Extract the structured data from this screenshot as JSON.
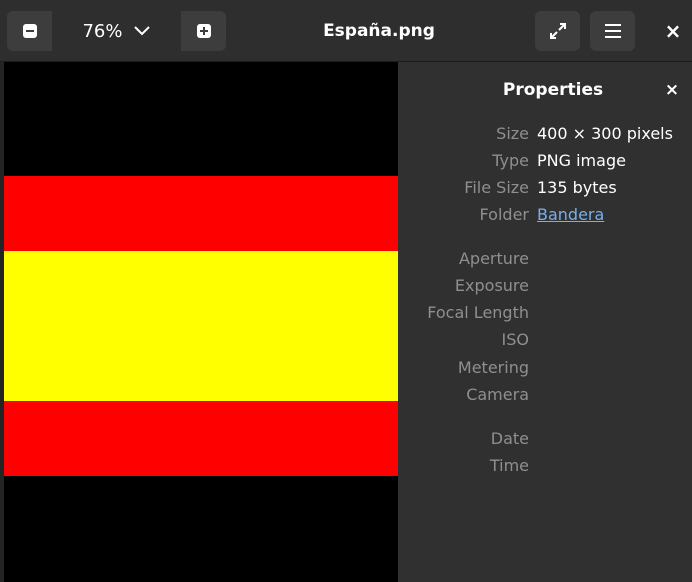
{
  "header": {
    "zoom_level": "76%",
    "title": "España.png",
    "icons": {
      "zoom_out": "minus-icon",
      "zoom_dropdown": "chevron-down-icon",
      "zoom_in": "plus-icon",
      "fullscreen": "expand-icon",
      "menu": "hamburger-menu-icon",
      "close": "close-icon"
    },
    "close_glyph": "×"
  },
  "image": {
    "colors": {
      "background": "#000000",
      "red": "#ff0000",
      "yellow": "#ffff00"
    }
  },
  "properties": {
    "title": "Properties",
    "close_glyph": "×",
    "size_label": "Size",
    "size_value": "400 × 300 pixels",
    "type_label": "Type",
    "type_value": "PNG image",
    "filesize_label": "File Size",
    "filesize_value": "135 bytes",
    "folder_label": "Folder",
    "folder_value": "Bandera",
    "aperture_label": "Aperture",
    "exposure_label": "Exposure",
    "focal_label": "Focal Length",
    "iso_label": "ISO",
    "metering_label": "Metering",
    "camera_label": "Camera",
    "date_label": "Date",
    "time_label": "Time"
  },
  "colors": {
    "accent_link": "#78aeed",
    "panel_bg": "#303030",
    "header_bg": "#2e2e2e"
  }
}
